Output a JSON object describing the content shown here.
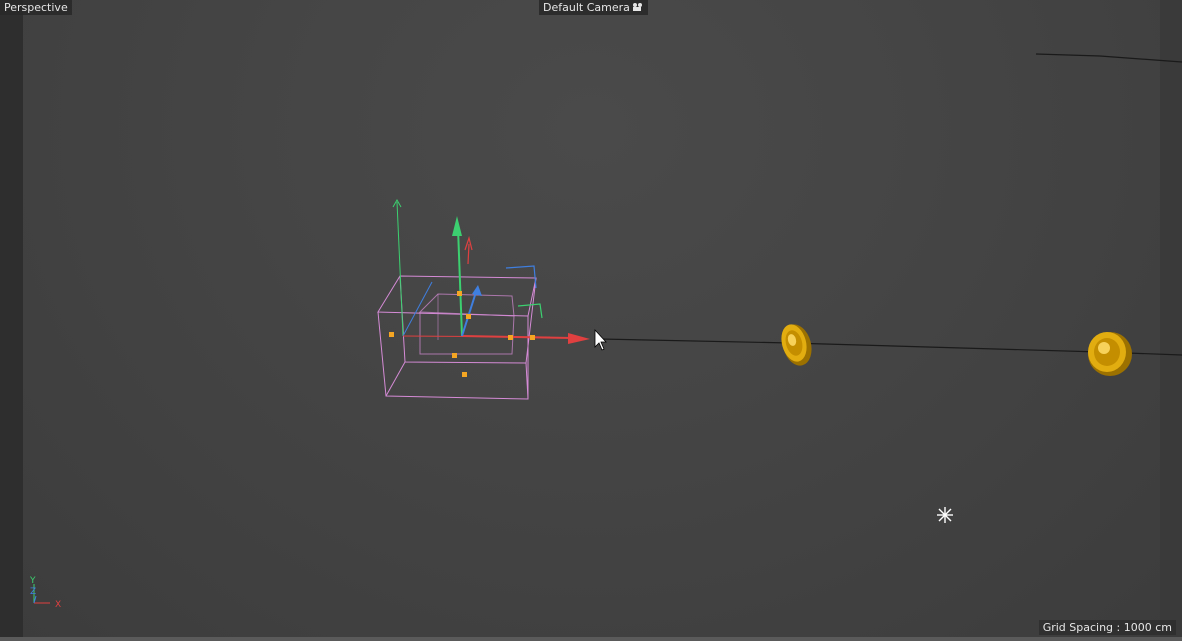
{
  "viewport": {
    "view_name": "Perspective",
    "camera_name": "Default Camera",
    "camera_icon": "camera-icon",
    "grid_spacing": "Grid Spacing : 1000 cm"
  },
  "axis_indicator": {
    "y_label": "Y",
    "z_label": "Z",
    "x_label": "X"
  },
  "colors": {
    "background": "#454545",
    "bounding_box": "#d58bd6",
    "handles": "#f5a623",
    "axis_x": "#e04040",
    "axis_y": "#3cd070",
    "axis_z": "#3f7fe0",
    "coin": "#d9a400",
    "spline": "#111111"
  }
}
